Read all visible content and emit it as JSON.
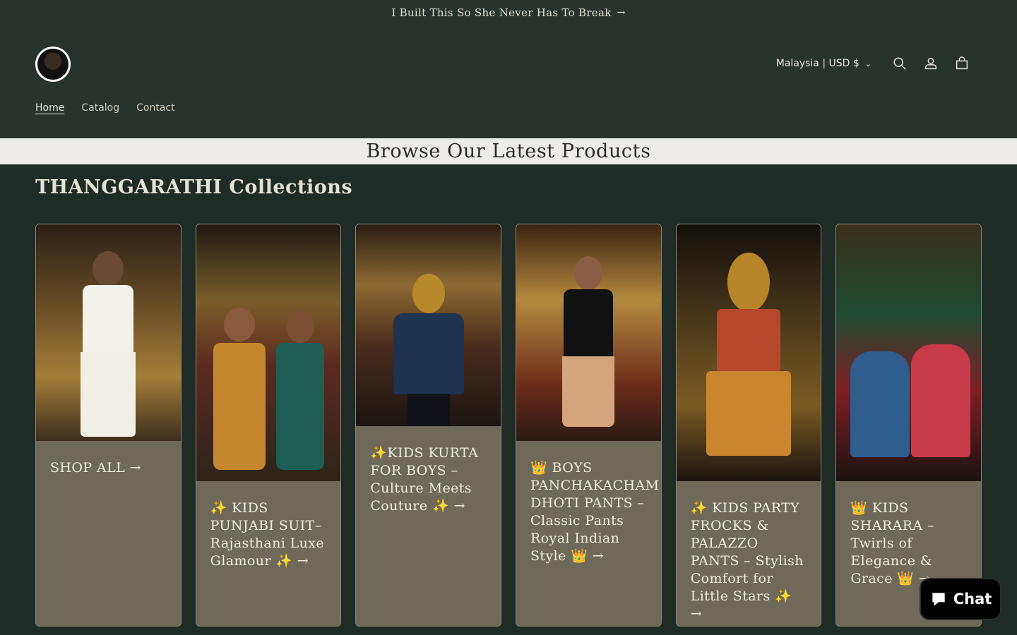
{
  "announcement": {
    "text": "I Built This So She Never Has To Break"
  },
  "header": {
    "country_selector": "Malaysia | USD $",
    "nav": [
      {
        "label": "Home",
        "active": true
      },
      {
        "label": "Catalog",
        "active": false
      },
      {
        "label": "Contact",
        "active": false
      }
    ]
  },
  "browse_banner": "Browse Our Latest Products",
  "collections": {
    "title": "THANGGARATHI Collections",
    "cards": [
      {
        "label": "SHOP ALL →"
      },
      {
        "label": "✨ KIDS PUNJABI SUIT–Rajasthani Luxe Glamour ✨ →"
      },
      {
        "label": "✨KIDS KURTA FOR BOYS – Culture Meets Couture ✨ →"
      },
      {
        "label": "👑 BOYS PANCHAKACHAM DHOTI PANTS – Classic Pants Royal Indian Style 👑 →"
      },
      {
        "label": "✨ KIDS PARTY FROCKS & PALAZZO PANTS – Stylish Comfort for Little Stars ✨ →"
      },
      {
        "label": "👑 KIDS SHARARA – Twirls of Elegance & Grace 👑 →"
      }
    ]
  },
  "chat": {
    "label": "Chat"
  },
  "colors": {
    "background": "#1f2b26",
    "header": "#28332e",
    "card": "#6e6959",
    "banner": "#eeecea"
  }
}
